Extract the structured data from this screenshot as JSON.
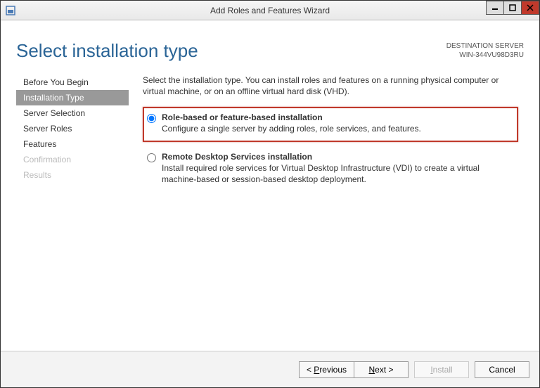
{
  "titlebar": {
    "title": "Add Roles and Features Wizard"
  },
  "header": {
    "page_title": "Select installation type",
    "dest_label": "DESTINATION SERVER",
    "dest_value": "WIN-344VU98D3RU"
  },
  "nav": {
    "items": [
      {
        "label": "Before You Begin",
        "state": "normal"
      },
      {
        "label": "Installation Type",
        "state": "active"
      },
      {
        "label": "Server Selection",
        "state": "normal"
      },
      {
        "label": "Server Roles",
        "state": "normal"
      },
      {
        "label": "Features",
        "state": "normal"
      },
      {
        "label": "Confirmation",
        "state": "disabled"
      },
      {
        "label": "Results",
        "state": "disabled"
      }
    ]
  },
  "main": {
    "intro": "Select the installation type. You can install roles and features on a running physical computer or virtual machine, or on an offline virtual hard disk (VHD).",
    "options": [
      {
        "title": "Role-based or feature-based installation",
        "desc": "Configure a single server by adding roles, role services, and features.",
        "selected": true,
        "highlight": true
      },
      {
        "title": "Remote Desktop Services installation",
        "desc": "Install required role services for Virtual Desktop Infrastructure (VDI) to create a virtual machine-based or session-based desktop deployment.",
        "selected": false,
        "highlight": false
      }
    ]
  },
  "footer": {
    "previous_prefix": "< ",
    "previous_u": "P",
    "previous_rest": "revious",
    "next_u": "N",
    "next_rest": "ext >",
    "install_u": "I",
    "install_rest": "nstall",
    "cancel": "Cancel"
  }
}
